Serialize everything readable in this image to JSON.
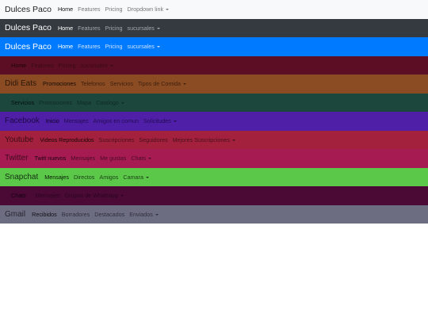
{
  "navbars": [
    {
      "brand": "Dulces Paco",
      "brand_color": "#222222",
      "active": "Home",
      "active_color": "#111111",
      "links": [
        "Features",
        "Pricing"
      ],
      "link_color": "#777777",
      "dropdown": "Dropdown link",
      "bg": "#f8f9fa"
    },
    {
      "brand": "Dulces Paco",
      "brand_color": "#ffffff",
      "active": "Home",
      "active_color": "#ffffff",
      "links": [
        "Features",
        "Pricing"
      ],
      "link_color": "#a3a7ab",
      "dropdown": "sucursales",
      "bg": "#343a40"
    },
    {
      "brand": "Dulces Paco",
      "brand_color": "#ffffff",
      "active": "Home",
      "active_color": "#ffffff",
      "links": [
        "Features",
        "Pricing"
      ],
      "link_color": "#cce0ff",
      "dropdown": "sucursales",
      "bg": "#007bff"
    },
    {
      "brand": "",
      "brand_color": "#3a0a16",
      "active": "Home",
      "active_color": "#1a0408",
      "links": [
        "Features",
        "Pricing"
      ],
      "link_color": "#3a0a16",
      "dropdown": "sucursales",
      "bg": "#5c0f24"
    },
    {
      "brand": "Didi Eats",
      "brand_color": "#2a1608",
      "active": "Promociones",
      "active_color": "#140a03",
      "links": [
        "Telefonos",
        "Servicios"
      ],
      "link_color": "#3d1f0c",
      "dropdown": "Tipos de Comida",
      "bg": "#8b4c24"
    },
    {
      "brand": "",
      "brand_color": "#0a2018",
      "active": "Servicios",
      "active_color": "#05100c",
      "links": [
        "Promociones",
        "Mapa"
      ],
      "link_color": "#0e2a22",
      "dropdown": "Catalogo",
      "bg": "#1b473d"
    },
    {
      "brand": "Facebook",
      "brand_color": "#1e0a45",
      "active": "Inicio",
      "active_color": "#0a0320",
      "links": [
        "Mensajes",
        "Amigos en comun"
      ],
      "link_color": "#230d52",
      "dropdown": "Solicitudes",
      "bg": "#4f1fa8"
    },
    {
      "brand": "Youtube",
      "brand_color": "#3d0c17",
      "active": "Videos Reproducidos",
      "active_color": "#1a0508",
      "links": [
        "Suscripciones",
        "Seguidores"
      ],
      "link_color": "#4a0f1c",
      "dropdown": "Mejores Suscripciones",
      "bg": "#a3213d"
    },
    {
      "brand": "Twitter",
      "brand_color": "#3d0a1e",
      "active": "Twitt nuevos",
      "active_color": "#1a0410",
      "links": [
        "Mensajes",
        "Me gustas"
      ],
      "link_color": "#4a0c25",
      "dropdown": "Chats",
      "bg": "#a61c52"
    },
    {
      "brand": "Snapchat",
      "brand_color": "#153012",
      "active": "Mensajes",
      "active_color": "#071805",
      "links": [
        "Directos",
        "Amigos"
      ],
      "link_color": "#1d4018",
      "dropdown": "Camara",
      "bg": "#5cc84a"
    },
    {
      "brand": "",
      "brand_color": "#2a0520",
      "active": "Chats",
      "active_color": "#120210",
      "links": [
        "",
        "Mensajes"
      ],
      "link_color": "#2a0520",
      "dropdown": "Grupos de Whatsapp",
      "bg": "#4a0a35"
    },
    {
      "brand": "Gmail",
      "brand_color": "#252530",
      "active": "Recibidos",
      "active_color": "#101015",
      "links": [
        "Borradores",
        "Destacados"
      ],
      "link_color": "#2e2e3c",
      "dropdown": "Enviados",
      "bg": "#6d6d82"
    }
  ]
}
